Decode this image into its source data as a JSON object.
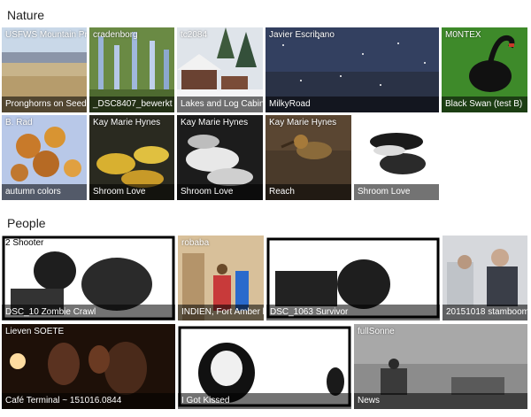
{
  "sections": {
    "nature": {
      "title": "Nature",
      "tiles": [
        {
          "author": "USFWS Mountain Prairie",
          "caption": "Pronghorns on Seedskadee"
        },
        {
          "author": "cradenborg",
          "caption": "_DSC8407_bewerkt"
        },
        {
          "author": "tc2084",
          "caption": "Lakes and Log Cabins"
        },
        {
          "author": "Javier Escribano",
          "caption": "MilkyRoad"
        },
        {
          "author": "M0NTEX",
          "caption": "Black Swan (test B)"
        },
        {
          "author": "B. Rad",
          "caption": "autumn colors"
        },
        {
          "author": "Kay Marie Hynes",
          "caption": "Shroom Love"
        },
        {
          "author": "Kay Marie Hynes",
          "caption": "Shroom Love"
        },
        {
          "author": "Kay Marie Hynes",
          "caption": "Reach"
        },
        {
          "author": "",
          "caption": "Shroom Love"
        }
      ]
    },
    "people": {
      "title": "People",
      "tiles": [
        {
          "author": "2 Shooter",
          "caption": "DSC_10 Zombie Crawl"
        },
        {
          "author": "robaba",
          "caption": "INDIEN, Fort Amber bei Jaipur"
        },
        {
          "author": "",
          "caption": "DSC_1063 Survivor"
        },
        {
          "author": "",
          "caption": "20151018 stamboom"
        },
        {
          "author": "Lieven SOETE",
          "caption": "Café Terminal ~ 151016.0844"
        },
        {
          "author": "",
          "caption": "I Got Kissed"
        },
        {
          "author": "fullSonne",
          "caption": "News"
        }
      ]
    }
  },
  "colors": {
    "caption_bar": "rgba(0,0,0,0.55)",
    "section_text": "#1f1f1f"
  }
}
